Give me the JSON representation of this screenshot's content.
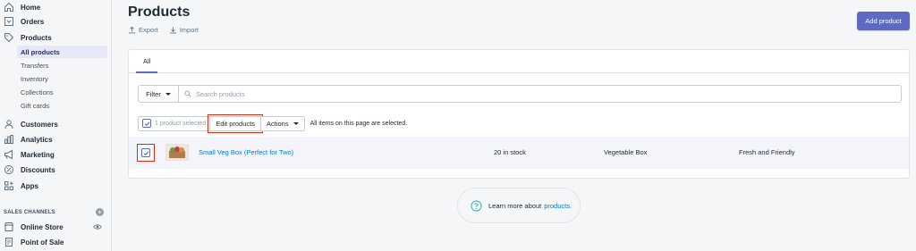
{
  "sidebar": {
    "nav": [
      {
        "label": "Home",
        "icon": "home-icon"
      },
      {
        "label": "Orders",
        "icon": "orders-icon"
      },
      {
        "label": "Products",
        "icon": "tag-icon"
      }
    ],
    "product_subnav": [
      {
        "label": "All products",
        "active": true
      },
      {
        "label": "Transfers"
      },
      {
        "label": "Inventory"
      },
      {
        "label": "Collections"
      },
      {
        "label": "Gift cards"
      }
    ],
    "nav2": [
      {
        "label": "Customers",
        "icon": "person-icon"
      },
      {
        "label": "Analytics",
        "icon": "bar-chart-icon"
      },
      {
        "label": "Marketing",
        "icon": "megaphone-icon"
      },
      {
        "label": "Discounts",
        "icon": "discount-icon"
      },
      {
        "label": "Apps",
        "icon": "apps-icon"
      }
    ],
    "channels_heading": "SALES CHANNELS",
    "channels": [
      {
        "label": "Online Store",
        "icon": "store-icon"
      },
      {
        "label": "Point of Sale",
        "icon": "pos-icon"
      }
    ]
  },
  "header": {
    "title": "Products",
    "export_label": "Export",
    "import_label": "Import",
    "add_label": "Add product"
  },
  "tabs": [
    {
      "label": "All"
    }
  ],
  "filter": {
    "button_label": "Filter",
    "search_placeholder": "Search products"
  },
  "bulk": {
    "selected_text": "1 product selected",
    "edit_label": "Edit products",
    "actions_label": "Actions",
    "all_selected_text": "All items on this page are selected."
  },
  "products": [
    {
      "name": "Small Veg Box (Perfect for Two)",
      "inventory": "20 in stock",
      "type": "Vegetable Box",
      "vendor": "Fresh and Friendly"
    }
  ],
  "learn_more": {
    "text": "Learn more about",
    "link": "products."
  },
  "colors": {
    "accent": "#5c6ac4",
    "link": "#007ace",
    "highlight": "#d82c0d"
  }
}
